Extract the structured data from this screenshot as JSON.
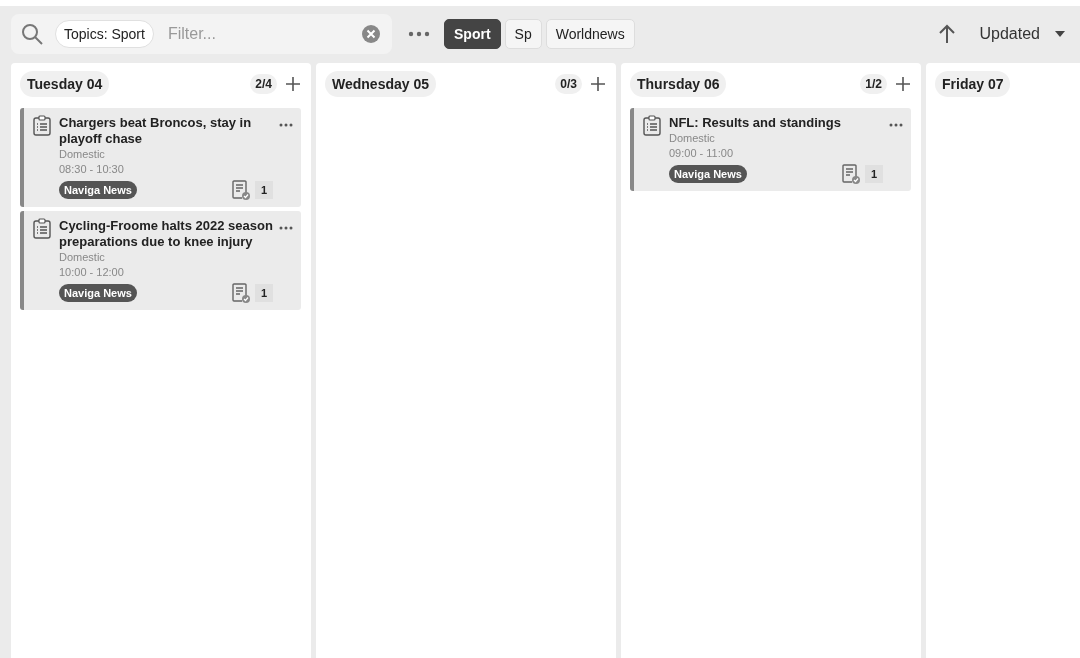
{
  "search": {
    "token": "Topics: Sport",
    "placeholder": "Filter..."
  },
  "filters": [
    {
      "label": "Sport",
      "selected": true
    },
    {
      "label": "Sp",
      "selected": false
    },
    {
      "label": "Worldnews",
      "selected": false
    }
  ],
  "sort": {
    "label": "Updated"
  },
  "columns": [
    {
      "title": "Tuesday 04",
      "count": "2/4",
      "items": [
        {
          "title": "Chargers beat Broncos, stay in playoff chase",
          "section": "Domestic",
          "time": "08:30 - 10:30",
          "tag": "Naviga News",
          "assignments": "1"
        },
        {
          "title": "Cycling-Froome halts 2022 season preparations due to knee injury",
          "section": "Domestic",
          "time": "10:00 - 12:00",
          "tag": "Naviga News",
          "assignments": "1"
        }
      ]
    },
    {
      "title": "Wednesday 05",
      "count": "0/3"
    },
    {
      "title": "Thursday 06",
      "count": "1/2",
      "items": [
        {
          "title": "NFL: Results and standings",
          "section": "Domestic",
          "time": "09:00 - 11:00",
          "tag": "Naviga News",
          "assignments": "1"
        }
      ]
    },
    {
      "title": "Friday 07"
    }
  ]
}
